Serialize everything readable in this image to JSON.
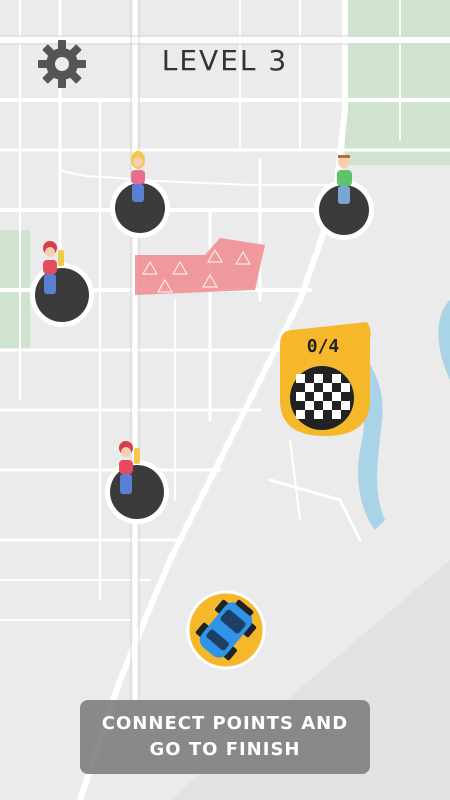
{
  "level": {
    "label": "LEVEL 3"
  },
  "progress": {
    "text": "0/4",
    "collected": 0,
    "total": 4
  },
  "instruction": {
    "line1": "CONNECT POINTS AND",
    "line2": "GO TO FINISH"
  },
  "colors": {
    "map_bg": "#ebebeb",
    "road": "#ffffff",
    "park": "#cfe3cf",
    "water": "#a9d3e6",
    "pad": "#3b3b3b",
    "finish_flag": "#f4b82a",
    "danger_zone": "#f08a8f",
    "car_body": "#2f93e8",
    "car_ring": "#f4b82a"
  },
  "icons": {
    "settings": "gear-icon",
    "finish": "checkered-flag-icon",
    "car": "car-icon",
    "danger": "warning-icon"
  },
  "characters": [
    {
      "name": "girl-blonde",
      "hair": "#f2c84b",
      "shirt": "#e86c8b",
      "pants": "#5a7fd4"
    },
    {
      "name": "man-green",
      "hair": "#b56a3a",
      "shirt": "#5fc36e",
      "pants": "#7aa5d6"
    },
    {
      "name": "girl-red-helmet-top",
      "hair": "#d93b4f",
      "shirt": "#e84a5f",
      "pants": "#5a7fd4"
    },
    {
      "name": "girl-red-helmet-bottom",
      "hair": "#d93b4f",
      "shirt": "#e84a5f",
      "pants": "#5a7fd4"
    }
  ]
}
